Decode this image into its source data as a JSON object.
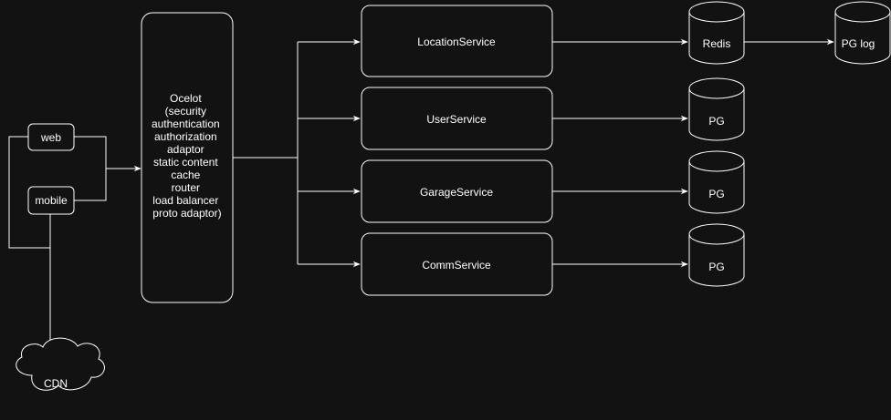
{
  "clients": {
    "web": "web",
    "mobile": "mobile"
  },
  "cdn": "CDN",
  "gateway": {
    "lines": [
      "Ocelot",
      "(security",
      "authentication",
      "authorization",
      "adaptor",
      "static content",
      "cache",
      "router",
      "load balancer",
      "proto adaptor)"
    ]
  },
  "services": [
    {
      "label": "LocationService"
    },
    {
      "label": "UserService"
    },
    {
      "label": "GarageService"
    },
    {
      "label": "CommService"
    }
  ],
  "datastores": [
    {
      "label": "Redis"
    },
    {
      "label": "PG"
    },
    {
      "label": "PG"
    },
    {
      "label": "PG"
    }
  ],
  "log_store": {
    "label": "PG log"
  },
  "colors": {
    "background": "#121212",
    "stroke": "#ffffff",
    "text": "#ffffff"
  }
}
